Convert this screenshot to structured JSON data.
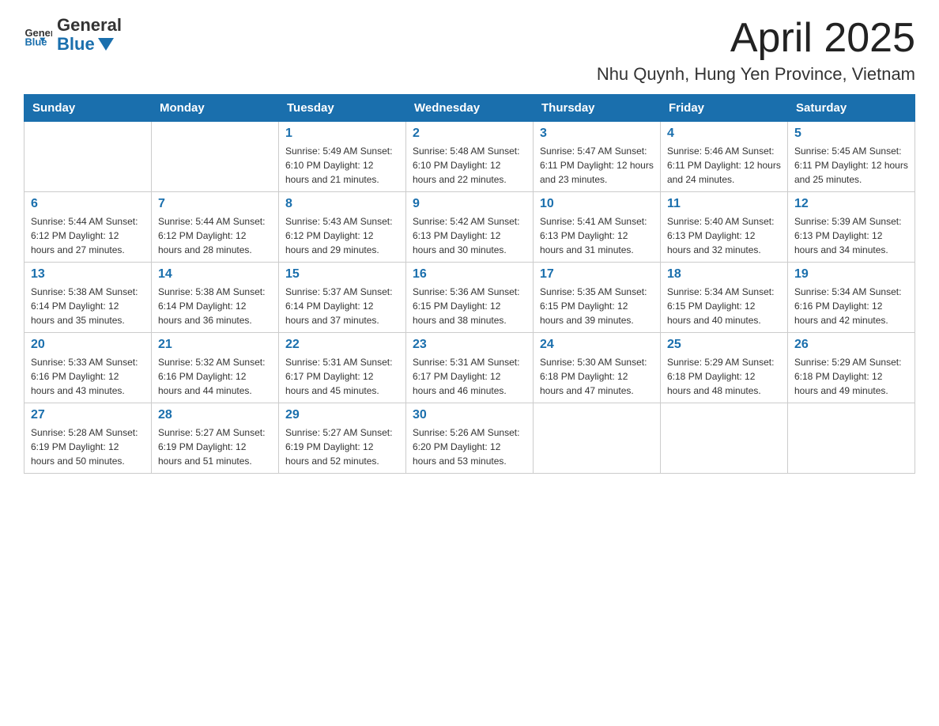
{
  "header": {
    "logo_text_general": "General",
    "logo_text_blue": "Blue",
    "month_title": "April 2025",
    "location": "Nhu Quynh, Hung Yen Province, Vietnam"
  },
  "weekdays": [
    "Sunday",
    "Monday",
    "Tuesday",
    "Wednesday",
    "Thursday",
    "Friday",
    "Saturday"
  ],
  "weeks": [
    [
      {
        "day": "",
        "info": ""
      },
      {
        "day": "",
        "info": ""
      },
      {
        "day": "1",
        "info": "Sunrise: 5:49 AM\nSunset: 6:10 PM\nDaylight: 12 hours\nand 21 minutes."
      },
      {
        "day": "2",
        "info": "Sunrise: 5:48 AM\nSunset: 6:10 PM\nDaylight: 12 hours\nand 22 minutes."
      },
      {
        "day": "3",
        "info": "Sunrise: 5:47 AM\nSunset: 6:11 PM\nDaylight: 12 hours\nand 23 minutes."
      },
      {
        "day": "4",
        "info": "Sunrise: 5:46 AM\nSunset: 6:11 PM\nDaylight: 12 hours\nand 24 minutes."
      },
      {
        "day": "5",
        "info": "Sunrise: 5:45 AM\nSunset: 6:11 PM\nDaylight: 12 hours\nand 25 minutes."
      }
    ],
    [
      {
        "day": "6",
        "info": "Sunrise: 5:44 AM\nSunset: 6:12 PM\nDaylight: 12 hours\nand 27 minutes."
      },
      {
        "day": "7",
        "info": "Sunrise: 5:44 AM\nSunset: 6:12 PM\nDaylight: 12 hours\nand 28 minutes."
      },
      {
        "day": "8",
        "info": "Sunrise: 5:43 AM\nSunset: 6:12 PM\nDaylight: 12 hours\nand 29 minutes."
      },
      {
        "day": "9",
        "info": "Sunrise: 5:42 AM\nSunset: 6:13 PM\nDaylight: 12 hours\nand 30 minutes."
      },
      {
        "day": "10",
        "info": "Sunrise: 5:41 AM\nSunset: 6:13 PM\nDaylight: 12 hours\nand 31 minutes."
      },
      {
        "day": "11",
        "info": "Sunrise: 5:40 AM\nSunset: 6:13 PM\nDaylight: 12 hours\nand 32 minutes."
      },
      {
        "day": "12",
        "info": "Sunrise: 5:39 AM\nSunset: 6:13 PM\nDaylight: 12 hours\nand 34 minutes."
      }
    ],
    [
      {
        "day": "13",
        "info": "Sunrise: 5:38 AM\nSunset: 6:14 PM\nDaylight: 12 hours\nand 35 minutes."
      },
      {
        "day": "14",
        "info": "Sunrise: 5:38 AM\nSunset: 6:14 PM\nDaylight: 12 hours\nand 36 minutes."
      },
      {
        "day": "15",
        "info": "Sunrise: 5:37 AM\nSunset: 6:14 PM\nDaylight: 12 hours\nand 37 minutes."
      },
      {
        "day": "16",
        "info": "Sunrise: 5:36 AM\nSunset: 6:15 PM\nDaylight: 12 hours\nand 38 minutes."
      },
      {
        "day": "17",
        "info": "Sunrise: 5:35 AM\nSunset: 6:15 PM\nDaylight: 12 hours\nand 39 minutes."
      },
      {
        "day": "18",
        "info": "Sunrise: 5:34 AM\nSunset: 6:15 PM\nDaylight: 12 hours\nand 40 minutes."
      },
      {
        "day": "19",
        "info": "Sunrise: 5:34 AM\nSunset: 6:16 PM\nDaylight: 12 hours\nand 42 minutes."
      }
    ],
    [
      {
        "day": "20",
        "info": "Sunrise: 5:33 AM\nSunset: 6:16 PM\nDaylight: 12 hours\nand 43 minutes."
      },
      {
        "day": "21",
        "info": "Sunrise: 5:32 AM\nSunset: 6:16 PM\nDaylight: 12 hours\nand 44 minutes."
      },
      {
        "day": "22",
        "info": "Sunrise: 5:31 AM\nSunset: 6:17 PM\nDaylight: 12 hours\nand 45 minutes."
      },
      {
        "day": "23",
        "info": "Sunrise: 5:31 AM\nSunset: 6:17 PM\nDaylight: 12 hours\nand 46 minutes."
      },
      {
        "day": "24",
        "info": "Sunrise: 5:30 AM\nSunset: 6:18 PM\nDaylight: 12 hours\nand 47 minutes."
      },
      {
        "day": "25",
        "info": "Sunrise: 5:29 AM\nSunset: 6:18 PM\nDaylight: 12 hours\nand 48 minutes."
      },
      {
        "day": "26",
        "info": "Sunrise: 5:29 AM\nSunset: 6:18 PM\nDaylight: 12 hours\nand 49 minutes."
      }
    ],
    [
      {
        "day": "27",
        "info": "Sunrise: 5:28 AM\nSunset: 6:19 PM\nDaylight: 12 hours\nand 50 minutes."
      },
      {
        "day": "28",
        "info": "Sunrise: 5:27 AM\nSunset: 6:19 PM\nDaylight: 12 hours\nand 51 minutes."
      },
      {
        "day": "29",
        "info": "Sunrise: 5:27 AM\nSunset: 6:19 PM\nDaylight: 12 hours\nand 52 minutes."
      },
      {
        "day": "30",
        "info": "Sunrise: 5:26 AM\nSunset: 6:20 PM\nDaylight: 12 hours\nand 53 minutes."
      },
      {
        "day": "",
        "info": ""
      },
      {
        "day": "",
        "info": ""
      },
      {
        "day": "",
        "info": ""
      }
    ]
  ]
}
